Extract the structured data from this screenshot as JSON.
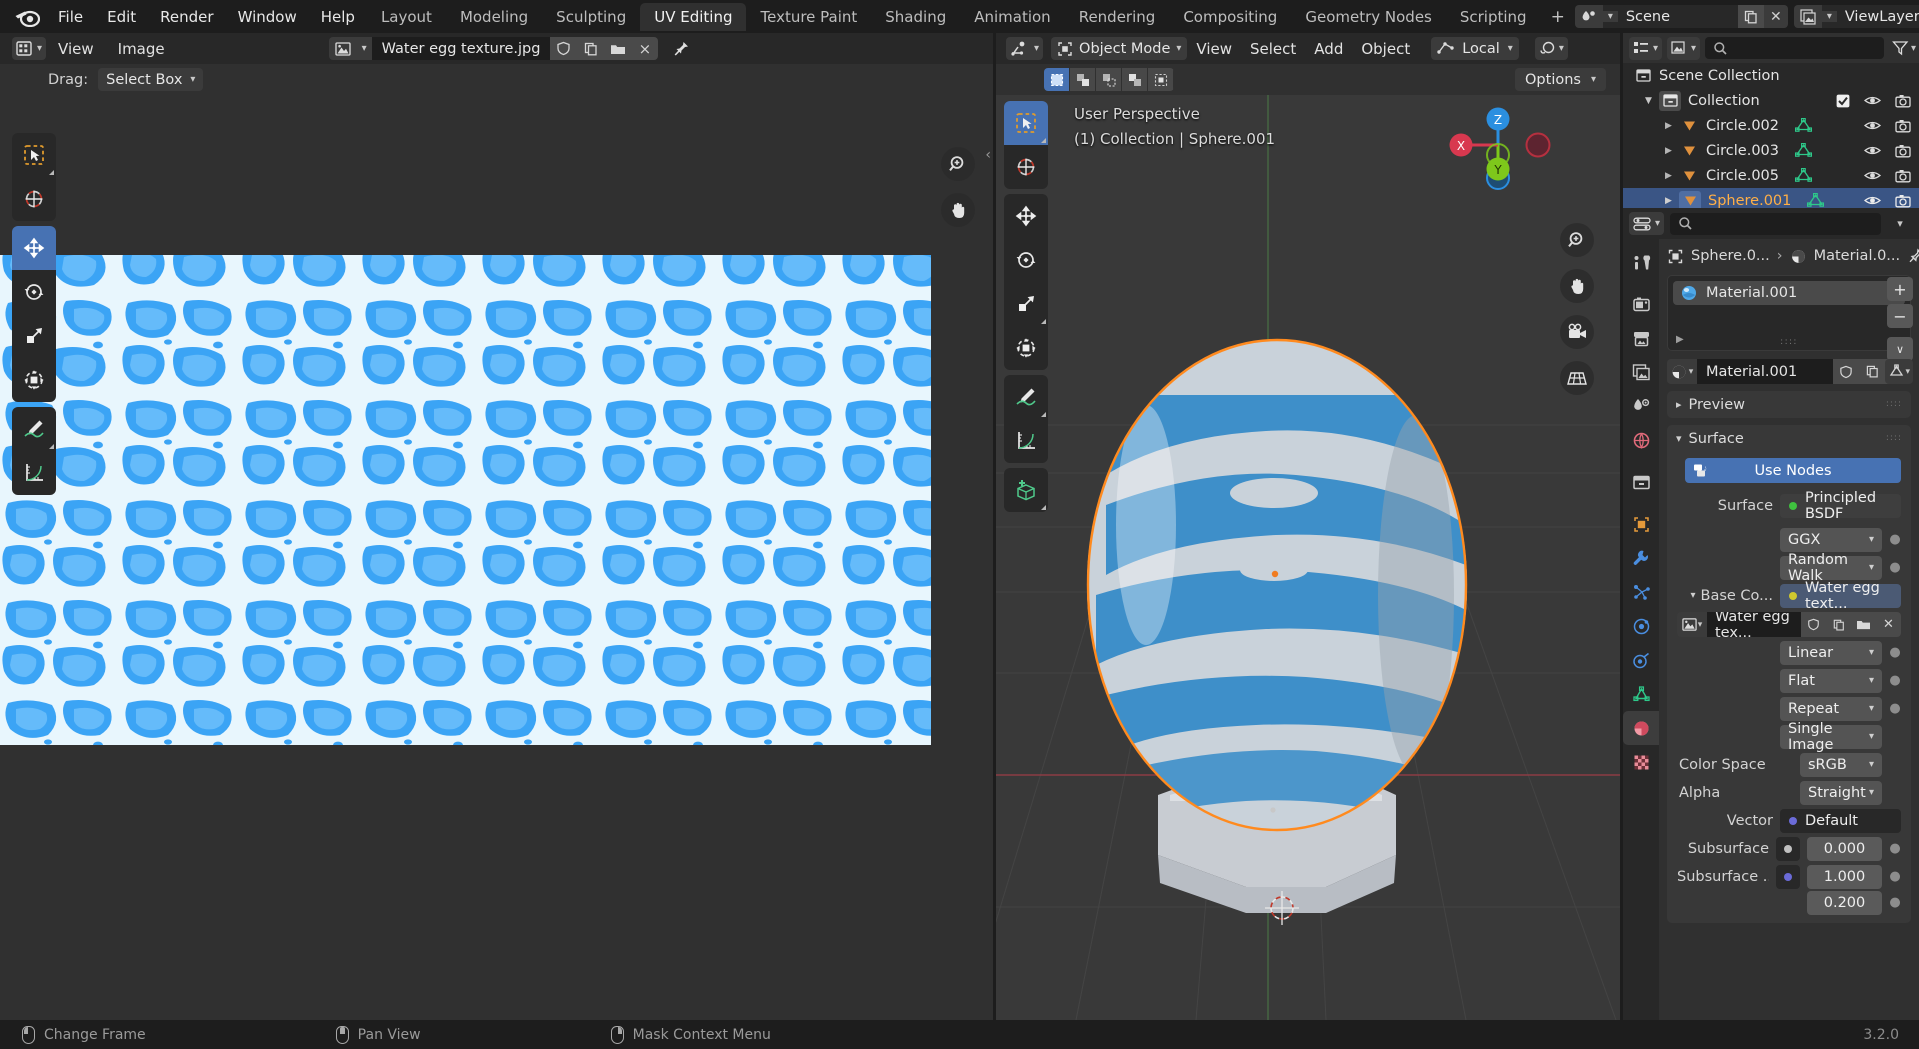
{
  "app": {
    "version": "3.2.0",
    "accent_blue": "#4772b3",
    "orange": "#ff8a1e",
    "bg_dark": "#1d1d1d",
    "bg_editor": "#303030",
    "bg_header": "#282828"
  },
  "topbar": {
    "menus": [
      "File",
      "Edit",
      "Render",
      "Window",
      "Help"
    ],
    "workspaces": [
      {
        "label": "Layout",
        "active": false
      },
      {
        "label": "Modeling",
        "active": false
      },
      {
        "label": "Sculpting",
        "active": false
      },
      {
        "label": "UV Editing",
        "active": true
      },
      {
        "label": "Texture Paint",
        "active": false
      },
      {
        "label": "Shading",
        "active": false
      },
      {
        "label": "Animation",
        "active": false
      },
      {
        "label": "Rendering",
        "active": false
      },
      {
        "label": "Compositing",
        "active": false
      },
      {
        "label": "Geometry Nodes",
        "active": false
      },
      {
        "label": "Scripting",
        "active": false
      }
    ],
    "add_workspace": "+",
    "scene": {
      "label": "Scene",
      "icon": "scene-icon"
    },
    "viewlayer": {
      "label": "ViewLayer",
      "icon": "viewlayer-icon"
    }
  },
  "uv_editor": {
    "header": {
      "editor_type": "uv-editor-icon",
      "menus": [
        "View",
        "Image"
      ],
      "image_name": "Water egg texture.jpg",
      "fake_user": "shield-icon",
      "new_copy": "copy-icon",
      "open": "folder-icon",
      "unlink": "×",
      "pin": "pin-icon"
    },
    "tool_settings": {
      "drag_label": "Drag:",
      "drag_value": "Select Box"
    },
    "tools": [
      {
        "name": "tweak-tool",
        "active": false
      },
      {
        "name": "cursor-tool",
        "active": false
      },
      {
        "name": "move-tool",
        "active": true
      },
      {
        "name": "rotate-tool",
        "active": false
      },
      {
        "name": "scale-tool",
        "active": false
      },
      {
        "name": "transform-tool",
        "active": false
      },
      {
        "name": "annotate-tool",
        "active": false
      },
      {
        "name": "measure-tool",
        "active": false
      }
    ],
    "right_gizmos": [
      "zoom-icon",
      "pan-icon"
    ]
  },
  "viewport": {
    "header": {
      "editor_type": "3d-viewport-icon",
      "mode": "Object Mode",
      "menus": [
        "View",
        "Select",
        "Add",
        "Object"
      ],
      "orientation": "Local",
      "snap_icon": "snap-icon",
      "proportional_icon": "proportional-edit-icon"
    },
    "select_modes": [
      "set",
      "extend",
      "subtract",
      "invert",
      "intersect"
    ],
    "options_label": "Options",
    "overlay_lines": [
      "User Perspective",
      "(1) Collection | Sphere.001"
    ],
    "gizmo_axes": [
      {
        "label": "Z",
        "color": "#2b8fe0"
      },
      {
        "label": "Y",
        "color": "#7ec81b"
      },
      {
        "label": "X",
        "color": "#d8384f"
      }
    ],
    "nav_buttons": [
      "zoom-icon",
      "pan-icon",
      "camera-icon",
      "perspective-icon"
    ],
    "tools": [
      {
        "name": "tweak-tool",
        "active": true
      },
      {
        "name": "cursor-tool",
        "active": false
      },
      {
        "name": "move-tool",
        "active": false
      },
      {
        "name": "rotate-tool",
        "active": false
      },
      {
        "name": "scale-tool",
        "active": false
      },
      {
        "name": "transform-tool",
        "active": false
      },
      {
        "name": "annotate-tool",
        "active": false
      },
      {
        "name": "measure-tool",
        "active": false
      },
      {
        "name": "add-cube-tool",
        "active": false
      }
    ]
  },
  "outliner": {
    "display_mode_icon": "outliner-display-icon",
    "filter_icon": "filter-icon",
    "search_placeholder": "",
    "rows": [
      {
        "label": "Scene Collection",
        "indent": 0,
        "icon": "scene-collection-icon",
        "selected": false,
        "has_disclosure": false,
        "checkbox": false,
        "eye": false,
        "camera": false
      },
      {
        "label": "Collection",
        "indent": 1,
        "icon": "collection-icon",
        "selected": false,
        "has_disclosure": true,
        "checkbox": true,
        "eye": true,
        "camera": true
      },
      {
        "label": "Circle.002",
        "indent": 2,
        "icon": "mesh-object-icon",
        "selected": false,
        "has_disclosure": true,
        "checkbox": false,
        "eye": true,
        "camera": true,
        "data_icon": "mesh-data-icon"
      },
      {
        "label": "Circle.003",
        "indent": 2,
        "icon": "mesh-object-icon",
        "selected": false,
        "has_disclosure": true,
        "checkbox": false,
        "eye": true,
        "camera": true,
        "data_icon": "mesh-data-icon"
      },
      {
        "label": "Circle.005",
        "indent": 2,
        "icon": "mesh-object-icon",
        "selected": false,
        "has_disclosure": true,
        "checkbox": false,
        "eye": true,
        "camera": true,
        "data_icon": "mesh-data-icon"
      },
      {
        "label": "Sphere.001",
        "indent": 2,
        "icon": "mesh-object-icon",
        "selected": true,
        "has_disclosure": true,
        "checkbox": false,
        "eye": true,
        "camera": true,
        "data_icon": "mesh-data-icon"
      }
    ]
  },
  "properties": {
    "editor_type_icon": "properties-editor-icon",
    "search_placeholder": "",
    "tabs": [
      {
        "name": "tool-tab",
        "color": "#c9c9c9",
        "active": false
      },
      {
        "name": "render-tab",
        "color": "#c9c9c9",
        "active": false
      },
      {
        "name": "output-tab",
        "color": "#c9c9c9",
        "active": false
      },
      {
        "name": "view-layer-tab",
        "color": "#c9c9c9",
        "active": false
      },
      {
        "name": "scene-tab",
        "color": "#c9c9c9",
        "active": false
      },
      {
        "name": "world-tab",
        "color": "#e06a7a",
        "active": false
      },
      {
        "name": "collection-tab",
        "color": "#c9c9c9",
        "active": false
      },
      {
        "name": "object-tab",
        "color": "#e59a3a",
        "active": false
      },
      {
        "name": "modifier-tab",
        "color": "#4a8ee0",
        "active": false
      },
      {
        "name": "particles-tab",
        "color": "#4a8ee0",
        "active": false
      },
      {
        "name": "physics-tab",
        "color": "#4a8ee0",
        "active": false
      },
      {
        "name": "constraints-tab",
        "color": "#4a8ee0",
        "active": false
      },
      {
        "name": "object-data-tab",
        "color": "#2ec98a",
        "active": false
      },
      {
        "name": "material-tab",
        "color": "#e06a7a",
        "active": true
      },
      {
        "name": "texture-tab",
        "color": "#e06a7a",
        "active": false
      }
    ],
    "breadcrumb": [
      "Sphere.0...",
      "Material.0..."
    ],
    "pin_icon": "pin-icon",
    "material_slots": [
      {
        "name": "Material.001",
        "icon": "material-sphere-icon",
        "selected": true
      }
    ],
    "slot_buttons": [
      "+",
      "−",
      "∨"
    ],
    "material_id": {
      "name": "Material.001",
      "fake_user": "shield-icon",
      "copy": "copy-icon",
      "unlink": "×",
      "browse": "material-browse-icon"
    },
    "panels": [
      {
        "title": "Preview",
        "open": false
      },
      {
        "title": "Surface",
        "open": true
      }
    ],
    "use_nodes_label": "Use Nodes",
    "rows": [
      {
        "label": "Surface",
        "type": "node",
        "value": "Principled BSDF",
        "dot": "#3fc13f",
        "deco": false
      },
      {
        "label": "",
        "type": "dropdown",
        "value": "GGX",
        "deco": true
      },
      {
        "label": "",
        "type": "dropdown",
        "value": "Random Walk",
        "deco": true
      },
      {
        "label": "Base Co...",
        "type": "node-link",
        "value": "Water egg text...",
        "dot": "#cfc82e",
        "deco": false,
        "disclosure": true
      },
      {
        "label": "",
        "type": "texture-id",
        "value": "Water egg tex...",
        "deco": false
      },
      {
        "label": "",
        "type": "dropdown",
        "value": "Linear",
        "deco": true
      },
      {
        "label": "",
        "type": "dropdown",
        "value": "Flat",
        "deco": true
      },
      {
        "label": "",
        "type": "dropdown",
        "value": "Repeat",
        "deco": true
      },
      {
        "label": "",
        "type": "dropdown",
        "value": "Single Image",
        "deco": false
      },
      {
        "label": "Color Space",
        "type": "dropdown-half",
        "value": "sRGB",
        "deco": false
      },
      {
        "label": "Alpha",
        "type": "dropdown-half",
        "value": "Straight",
        "deco": false
      },
      {
        "label": "Vector",
        "type": "node",
        "value": "Default",
        "dot": "#6b6bd8",
        "dark": true,
        "deco": false
      },
      {
        "label": "Subsurface",
        "type": "number-socket",
        "value": "0.000",
        "dot": "#c0c0c0",
        "deco": true
      },
      {
        "label": "Subsurface ...",
        "type": "number-socket",
        "value": "1.000",
        "dot": "#6b6bd8",
        "deco": true
      },
      {
        "label": "",
        "type": "number",
        "value": "0.200",
        "deco": true
      }
    ]
  },
  "statusbar": {
    "items": [
      {
        "mouse": "left",
        "label": "Change Frame"
      },
      {
        "mouse": "middle",
        "label": "Pan View"
      },
      {
        "mouse": "right",
        "label": "Mask Context Menu"
      }
    ],
    "version": "3.2.0"
  }
}
